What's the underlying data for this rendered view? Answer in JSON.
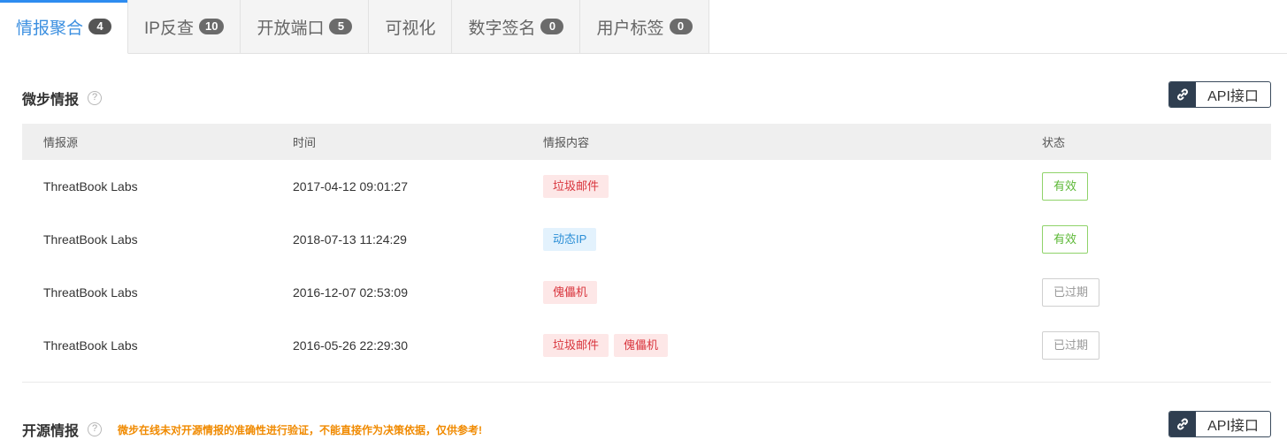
{
  "tabs": [
    {
      "label": "情报聚合",
      "count": "4",
      "active": true
    },
    {
      "label": "IP反查",
      "count": "10"
    },
    {
      "label": "开放端口",
      "count": "5"
    },
    {
      "label": "可视化"
    },
    {
      "label": "数字签名",
      "count": "0"
    },
    {
      "label": "用户标签",
      "count": "0"
    }
  ],
  "section1": {
    "title": "微步情报",
    "help": "?",
    "api_label": "API接口",
    "columns": [
      "情报源",
      "时间",
      "情报内容",
      "状态"
    ],
    "rows": [
      {
        "source": "ThreatBook Labs",
        "time": "2017-04-12 09:01:27",
        "tags": [
          {
            "text": "垃圾邮件",
            "color": "red"
          }
        ],
        "status": "有效",
        "status_type": "valid"
      },
      {
        "source": "ThreatBook Labs",
        "time": "2018-07-13 11:24:29",
        "tags": [
          {
            "text": "动态IP",
            "color": "blue"
          }
        ],
        "status": "有效",
        "status_type": "valid"
      },
      {
        "source": "ThreatBook Labs",
        "time": "2016-12-07 02:53:09",
        "tags": [
          {
            "text": "傀儡机",
            "color": "red"
          }
        ],
        "status": "已过期",
        "status_type": "expired"
      },
      {
        "source": "ThreatBook Labs",
        "time": "2016-05-26 22:29:30",
        "tags": [
          {
            "text": "垃圾邮件",
            "color": "red"
          },
          {
            "text": "傀儡机",
            "color": "red"
          }
        ],
        "status": "已过期",
        "status_type": "expired"
      }
    ]
  },
  "section2": {
    "title": "开源情报",
    "help": "?",
    "notice": "微步在线未对开源情报的准确性进行验证，不能直接作为决策依据，仅供参考!",
    "api_label": "API接口"
  },
  "colors": {
    "accent": "#2d8cf0",
    "valid": "#5cb836",
    "tag_red": "#d9363e",
    "tag_blue": "#2c8fd6",
    "notice": "#f08a00"
  },
  "icons": {
    "help": "question-circle-icon",
    "api": "link-icon"
  }
}
